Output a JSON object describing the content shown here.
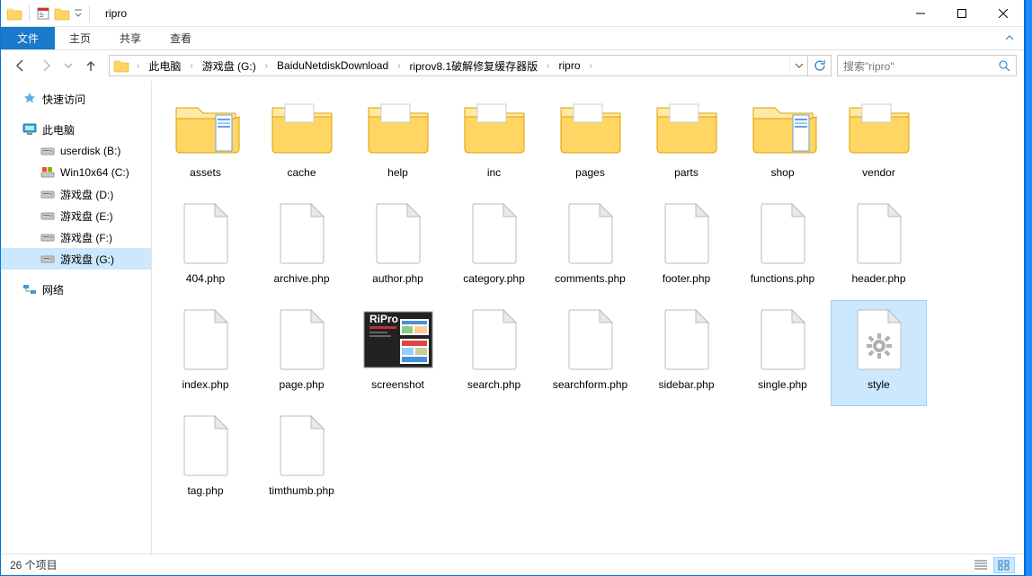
{
  "title": "ripro",
  "ribbon": {
    "file": "文件",
    "tabs": [
      "主页",
      "共享",
      "查看"
    ]
  },
  "breadcrumbs": [
    "此电脑",
    "游戏盘 (G:)",
    "BaiduNetdiskDownload",
    "riprov8.1破解修复缓存器版",
    "ripro"
  ],
  "search_placeholder": "搜索\"ripro\"",
  "nav": {
    "quick": "快速访问",
    "pc": "此电脑",
    "drives": [
      "userdisk (B:)",
      "Win10x64 (C:)",
      "游戏盘 (D:)",
      "游戏盘 (E:)",
      "游戏盘 (F:)",
      "游戏盘 (G:)"
    ],
    "net": "网络"
  },
  "items": [
    {
      "name": "assets",
      "type": "folder-open"
    },
    {
      "name": "cache",
      "type": "folder"
    },
    {
      "name": "help",
      "type": "folder"
    },
    {
      "name": "inc",
      "type": "folder"
    },
    {
      "name": "pages",
      "type": "folder"
    },
    {
      "name": "parts",
      "type": "folder"
    },
    {
      "name": "shop",
      "type": "folder-open"
    },
    {
      "name": "vendor",
      "type": "folder"
    },
    {
      "name": "404.php",
      "type": "file"
    },
    {
      "name": "archive.php",
      "type": "file"
    },
    {
      "name": "author.php",
      "type": "file"
    },
    {
      "name": "category.php",
      "type": "file"
    },
    {
      "name": "comments.php",
      "type": "file"
    },
    {
      "name": "footer.php",
      "type": "file"
    },
    {
      "name": "functions.php",
      "type": "file"
    },
    {
      "name": "header.php",
      "type": "file"
    },
    {
      "name": "index.php",
      "type": "file"
    },
    {
      "name": "page.php",
      "type": "file"
    },
    {
      "name": "screenshot",
      "type": "image"
    },
    {
      "name": "search.php",
      "type": "file"
    },
    {
      "name": "searchform.php",
      "type": "file"
    },
    {
      "name": "sidebar.php",
      "type": "file"
    },
    {
      "name": "single.php",
      "type": "file"
    },
    {
      "name": "style",
      "type": "css",
      "selected": true
    },
    {
      "name": "tag.php",
      "type": "file"
    },
    {
      "name": "timthumb.php",
      "type": "file"
    }
  ],
  "status": "26 个项目",
  "selected_drive_index": 5
}
